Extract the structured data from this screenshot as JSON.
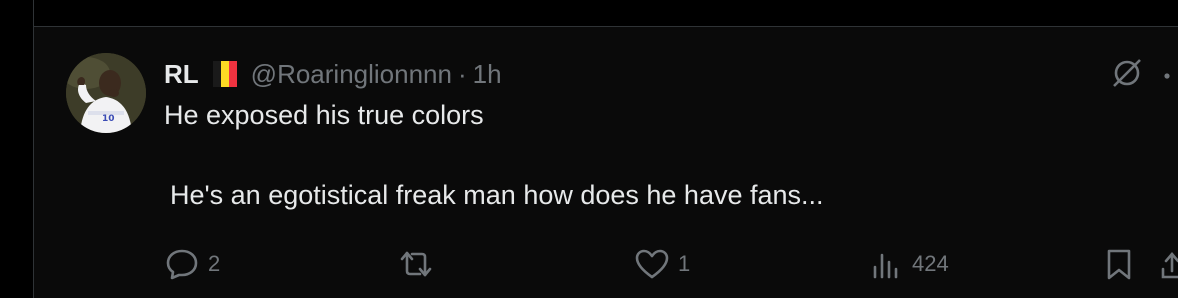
{
  "tweet": {
    "author_name": "RL",
    "flag_colors": [
      "#1a1a1a",
      "#fdda24",
      "#ef3340"
    ],
    "handle": "@Roaringlionnnn",
    "separator": "·",
    "time": "1h",
    "text_line_1": "He exposed his true colors",
    "text_line_2": "He's an egotistical freak man how does he have fans...",
    "avatar_jersey_number": "10"
  },
  "actions": {
    "replies": "2",
    "retweets": "",
    "likes": "1",
    "views": "424"
  },
  "icons": {
    "grok": "grok-slash-icon",
    "more": "more-dots-icon",
    "reply": "reply-bubble-icon",
    "retweet": "retweet-icon",
    "like": "heart-icon",
    "views": "views-bar-icon",
    "bookmark": "bookmark-icon",
    "share": "share-icon"
  },
  "colors": {
    "background": "#000000",
    "card": "#0a0a0a",
    "border": "#2f3336",
    "text": "#e7e9ea",
    "muted": "#71767b"
  }
}
